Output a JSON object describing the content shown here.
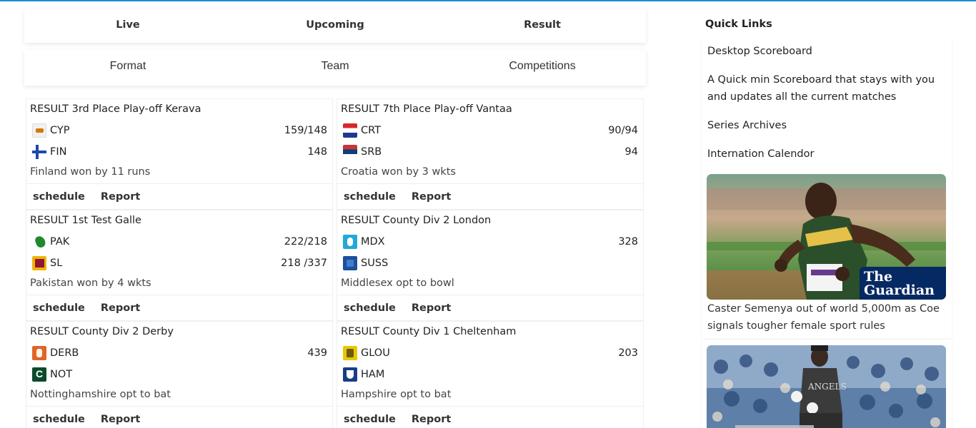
{
  "nav_primary": [
    "Live",
    "Upcoming",
    "Result"
  ],
  "nav_secondary": [
    "Format",
    "Team",
    "Competitions"
  ],
  "matches": [
    {
      "title": "RESULT 3rd Place Play-off Kerava",
      "team1": {
        "code": "CYP",
        "score": "159/148",
        "icon": "cyprus-flag-icon"
      },
      "team2": {
        "code": "FIN",
        "score": "148",
        "icon": "finland-flag-icon"
      },
      "result": "Finland won by 11 runs"
    },
    {
      "title": "RESULT 7th Place Play-off Vantaa",
      "team1": {
        "code": "CRT",
        "score": "90/94",
        "icon": "croatia-flag-icon"
      },
      "team2": {
        "code": "SRB",
        "score": "94",
        "icon": "serbia-flag-icon"
      },
      "result": "Croatia won by 3 wkts"
    },
    {
      "title": "RESULT 1st Test Galle",
      "team1": {
        "code": "PAK",
        "score": "222/218",
        "icon": "pakistan-flag-icon"
      },
      "team2": {
        "code": "SL",
        "score": "218 /337",
        "icon": "sri-lanka-flag-icon"
      },
      "result": "Pakistan won by 4 wkts"
    },
    {
      "title": "RESULT County Div 2 London",
      "team1": {
        "code": "MDX",
        "score": "328",
        "icon": "middlesex-crest-icon"
      },
      "team2": {
        "code": "SUSS",
        "score": "",
        "icon": "sussex-crest-icon"
      },
      "result": "Middlesex opt to bowl"
    },
    {
      "title": "RESULT County Div 2 Derby",
      "team1": {
        "code": "DERB",
        "score": "439",
        "icon": "derbyshire-crest-icon"
      },
      "team2": {
        "code": "NOT",
        "score": "",
        "icon": "nottinghamshire-crest-icon"
      },
      "result": "Nottinghamshire opt to bat"
    },
    {
      "title": "RESULT County Div 1 Cheltenham",
      "team1": {
        "code": "GLOU",
        "score": "203",
        "icon": "gloucestershire-crest-icon"
      },
      "team2": {
        "code": "HAM",
        "score": "",
        "icon": "hampshire-crest-icon"
      },
      "result": "Hampshire opt to bat"
    }
  ],
  "card_links": {
    "schedule": "schedule",
    "report": "Report"
  },
  "sidebar": {
    "title": "Quick Links",
    "links": [
      "Desktop Scoreboard",
      "A Quick min Scoreboard that stays with you and updates all the current matches",
      "Series Archives",
      "Internation Calendor"
    ],
    "news": [
      {
        "caption": "Caster Semenya out of world 5,000m as Coe signals tougher female sport rules",
        "brand": "The Guardian"
      }
    ]
  },
  "colors": {
    "accent_line": "#1a8fd6",
    "guardian_blue": "#052962"
  }
}
